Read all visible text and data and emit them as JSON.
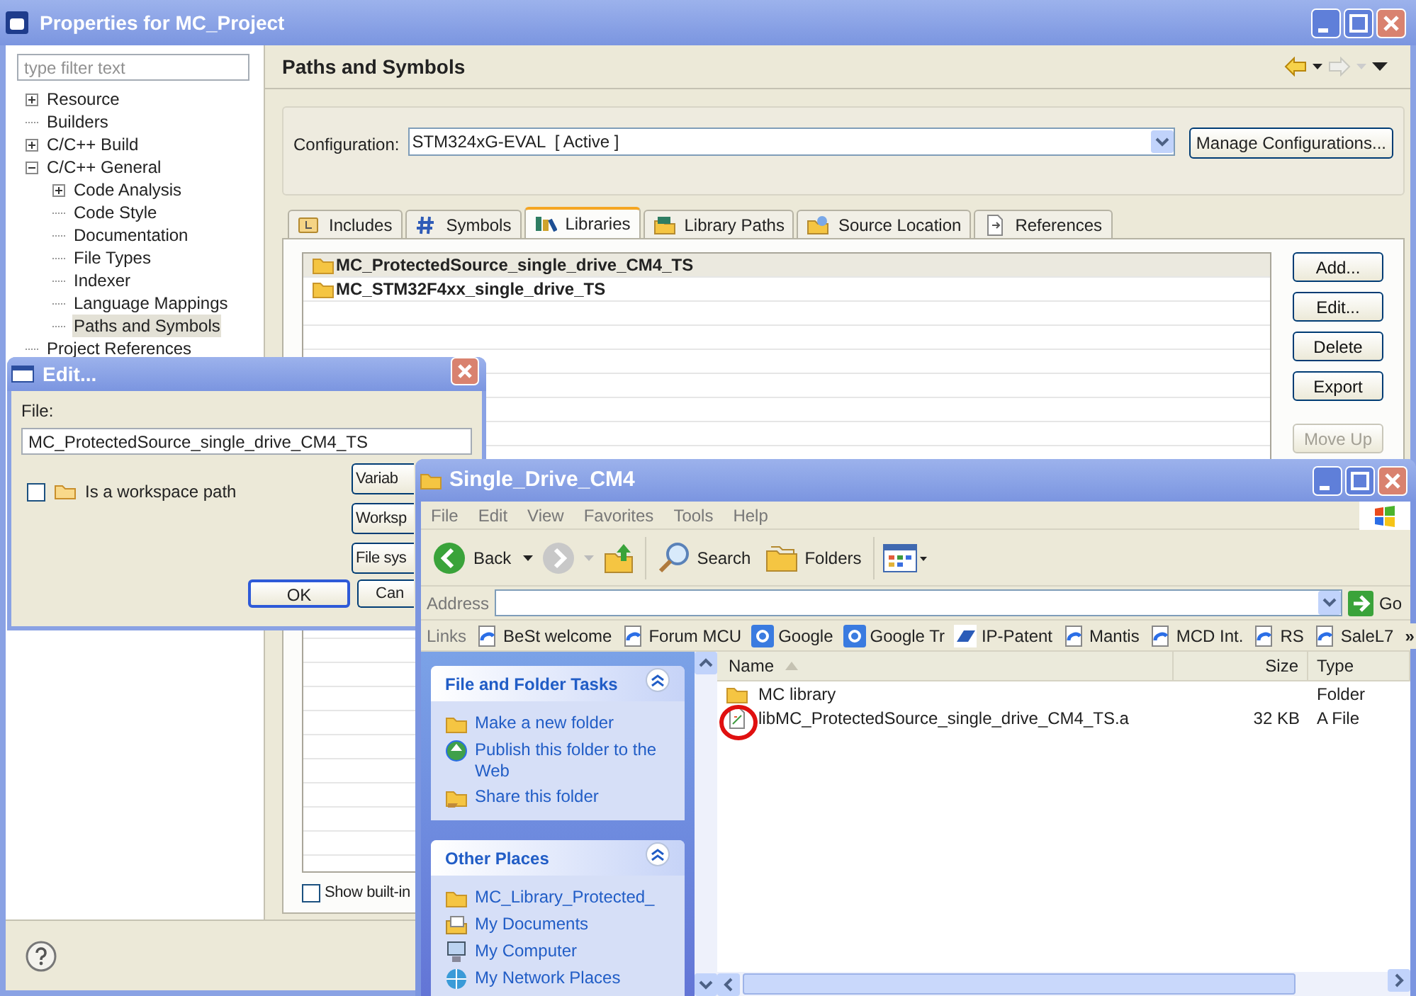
{
  "properties_window": {
    "title": "Properties for MC_Project",
    "filter": {
      "placeholder": "type filter text"
    },
    "tree": [
      {
        "label": "Resource",
        "expanded": false,
        "selected": false
      },
      {
        "label": "Builders",
        "selected": false
      },
      {
        "label": "C/C++ Build",
        "expanded": false,
        "selected": false
      },
      {
        "label": "C/C++ General",
        "expanded": true,
        "selected": false,
        "children": [
          {
            "label": "Code Analysis",
            "expanded": false,
            "selected": false
          },
          {
            "label": "Code Style",
            "selected": false
          },
          {
            "label": "Documentation",
            "selected": false
          },
          {
            "label": "File Types",
            "selected": false
          },
          {
            "label": "Indexer",
            "selected": false
          },
          {
            "label": "Language Mappings",
            "selected": false
          },
          {
            "label": "Paths and Symbols",
            "selected": true
          }
        ]
      },
      {
        "label": "Project References",
        "selected": false
      }
    ],
    "page_title": "Paths and Symbols",
    "configuration": {
      "label": "Configuration:",
      "value": "STM324xG-EVAL  [ Active ]"
    },
    "manage_button": "Manage Configurations...",
    "tabs": [
      {
        "label": "Includes",
        "kind": "includes",
        "selected": false
      },
      {
        "label": "Symbols",
        "kind": "symbols",
        "selected": false
      },
      {
        "label": "Libraries",
        "kind": "libraries",
        "selected": true
      },
      {
        "label": "Library Paths",
        "kind": "library-paths",
        "selected": false
      },
      {
        "label": "Source Location",
        "kind": "source",
        "selected": false
      },
      {
        "label": "References",
        "kind": "references",
        "selected": false
      }
    ],
    "libraries": [
      {
        "name": "MC_ProtectedSource_single_drive_CM4_TS",
        "selected": true
      },
      {
        "name": "MC_STM32F4xx_single_drive_TS",
        "selected": false
      }
    ],
    "buttons": [
      {
        "label": "Add...",
        "disabled": false
      },
      {
        "label": "Edit...",
        "disabled": false
      },
      {
        "label": "Delete",
        "disabled": false
      },
      {
        "label": "Export",
        "disabled": false
      },
      {
        "label": "Move Up",
        "disabled": true
      }
    ],
    "show_built_in": {
      "label": "Show built-in",
      "checked": false
    }
  },
  "edit_dialog": {
    "title": "Edit...",
    "file_label": "File:",
    "file_value": "MC_ProtectedSource_single_drive_CM4_TS",
    "workspace_path": {
      "label": "Is a workspace path",
      "checked": false
    },
    "side_buttons": [
      "Variab",
      "Worksp",
      "File sys"
    ],
    "buttons": [
      "OK",
      "Can"
    ]
  },
  "explorer": {
    "title": "Single_Drive_CM4",
    "menu": [
      "File",
      "Edit",
      "View",
      "Favorites",
      "Tools",
      "Help"
    ],
    "toolbar": {
      "back": "Back",
      "search": "Search",
      "folders": "Folders"
    },
    "address_label": "Address",
    "go": "Go",
    "links_label": "Links",
    "links": [
      {
        "label": "BeSt welcome",
        "kind": "page"
      },
      {
        "label": "Forum MCU",
        "kind": "page"
      },
      {
        "label": "Google",
        "kind": "google"
      },
      {
        "label": "Google Tr",
        "kind": "google"
      },
      {
        "label": "IP-Patent",
        "kind": "st"
      },
      {
        "label": "Mantis",
        "kind": "page"
      },
      {
        "label": "MCD Int.",
        "kind": "page"
      },
      {
        "label": "RS",
        "kind": "page"
      },
      {
        "label": "SaleL7",
        "kind": "page"
      }
    ],
    "links_more": "»",
    "task_panels": [
      {
        "title": "File and Folder Tasks",
        "items": [
          {
            "label": "Make a new folder",
            "kind": "new-folder"
          },
          {
            "label": "Publish this folder to the Web",
            "kind": "globe"
          },
          {
            "label": "Share this folder",
            "kind": "share"
          }
        ]
      },
      {
        "title": "Other Places",
        "items": [
          {
            "label": "MC_Library_Protected_",
            "kind": "folder"
          },
          {
            "label": "My Documents",
            "kind": "documents"
          },
          {
            "label": "My Computer",
            "kind": "computer"
          },
          {
            "label": "My Network Places",
            "kind": "network"
          }
        ]
      }
    ],
    "columns": [
      "Name",
      "Size",
      "Type"
    ],
    "files": [
      {
        "name": "MC library",
        "type": "Folder",
        "kind": "folder"
      },
      {
        "name": "libMC_ProtectedSource_single_drive_CM4_TS.a",
        "size": "32 KB",
        "type": "A File",
        "kind": "file"
      }
    ]
  }
}
